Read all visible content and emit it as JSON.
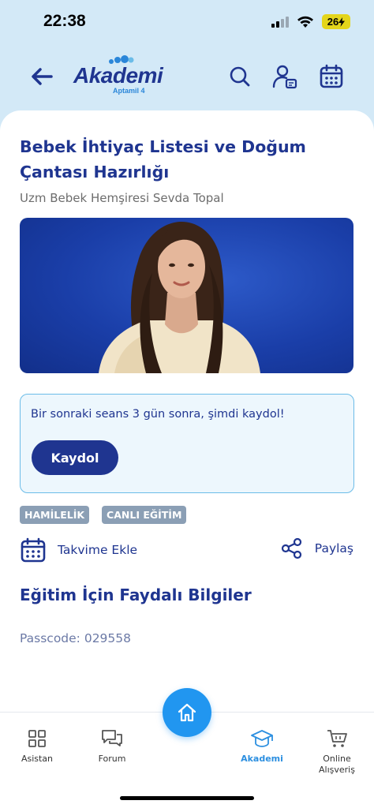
{
  "status": {
    "time": "22:38",
    "battery": "26"
  },
  "header": {
    "logo_text": "Akademi",
    "logo_sub": "Aptamil 4",
    "icons": [
      "back-arrow-icon",
      "search-icon",
      "user-profile-icon",
      "calendar-icon"
    ]
  },
  "content": {
    "title": "Bebek İhtiyaç Listesi ve Doğum Çantası Hazırlığı",
    "author": "Uzm Bebek Hemşiresi Sevda Topal",
    "session_text": "Bir sonraki seans 3 gün sonra, şimdi kaydol!",
    "register_label": "Kaydol",
    "tags": [
      "HAMİLELİK",
      "CANLI EĞİTİM"
    ],
    "calendar_label": "Takvime Ekle",
    "share_label": "Paylaş",
    "section_title": "Eğitim İçin Faydalı Bilgiler",
    "passcode": "Passcode: 029558"
  },
  "bottom_nav": {
    "items": [
      {
        "label": "Asistan",
        "icon": "grid-icon"
      },
      {
        "label": "Forum",
        "icon": "chat-icon"
      },
      {
        "label": "Akademi",
        "icon": "graduation-cap-icon",
        "active": true
      },
      {
        "label": "Online Alışveriş",
        "icon": "cart-icon"
      }
    ],
    "home_icon": "home-icon"
  },
  "colors": {
    "primary": "#1f3590",
    "accent": "#2196f0",
    "header_bg": "#d3e9f7",
    "tag_bg": "#8b9fb5"
  }
}
